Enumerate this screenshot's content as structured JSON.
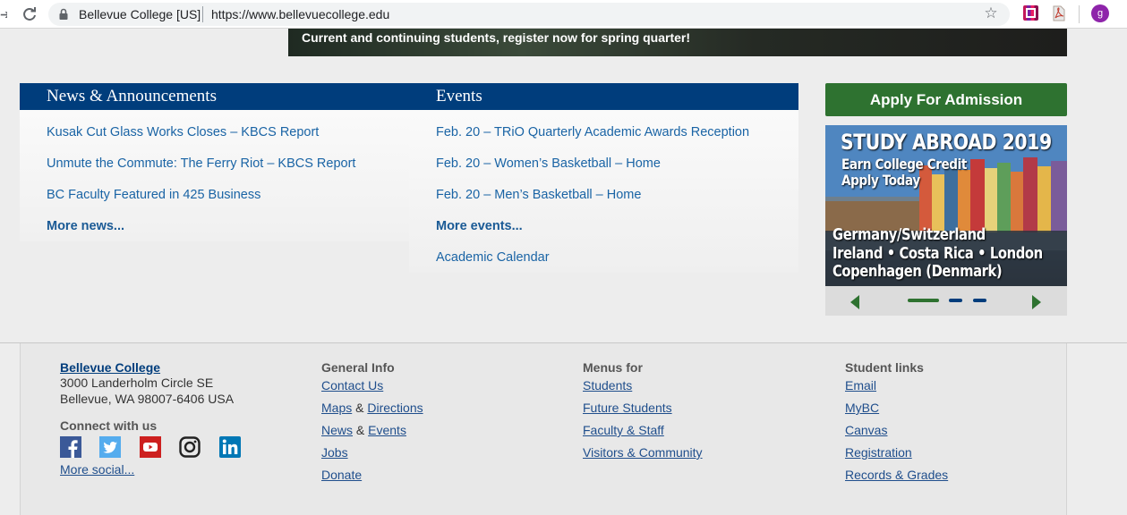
{
  "browser": {
    "site_name": "Bellevue College [US]",
    "url": "https://www.bellevuecollege.edu",
    "profile_initial": "g"
  },
  "hero": {
    "text": "Current and continuing students, register now for spring quarter!"
  },
  "news": {
    "title": "News & Announcements",
    "items": [
      "Kusak Cut Glass Works Closes – KBCS Report",
      "Unmute the Commute: The Ferry Riot – KBCS Report",
      "BC Faculty Featured in 425 Business"
    ],
    "more": "More news..."
  },
  "events": {
    "title": "Events",
    "items": [
      "Feb. 20 – TRiO Quarterly Academic Awards Reception",
      "Feb. 20 – Women’s Basketball – Home",
      "Feb. 20 – Men’s Basketball – Home"
    ],
    "more": "More events...",
    "calendar": "Academic Calendar"
  },
  "sidebar": {
    "apply_label": "Apply For Admission",
    "promo": {
      "line1": "STUDY ABROAD 2019",
      "line2": "Earn College Credit",
      "line3": "Apply Today",
      "line4": "Germany/Switzerland",
      "line5": "Ireland • Costa Rica • London",
      "line6": "Copenhagen (Denmark)"
    },
    "carousel": {
      "slides": 3,
      "active": 1
    }
  },
  "footer": {
    "college": {
      "name": "Bellevue College",
      "address1": "3000 Landerholm Circle SE",
      "address2": "Bellevue, WA 98007-6406 USA",
      "connect": "Connect with us",
      "more_social": "More social..."
    },
    "general": {
      "heading": "General Info",
      "contact": "Contact Us",
      "maps": "Maps",
      "amp1": "&",
      "directions": "Directions",
      "news": "News",
      "amp2": "&",
      "events": "Events",
      "jobs": "Jobs",
      "donate": "Donate"
    },
    "menus": {
      "heading": "Menus for",
      "items": [
        "Students",
        "Future Students",
        "Faculty & Staff",
        "Visitors & Community"
      ]
    },
    "student": {
      "heading": "Student links",
      "items": [
        "Email",
        "MyBC",
        "Canvas",
        "Registration",
        "Records & Grades"
      ]
    }
  },
  "colors": {
    "brand_blue": "#003d7c",
    "link_blue": "#1a64a5",
    "apply_green": "#2e7230"
  }
}
